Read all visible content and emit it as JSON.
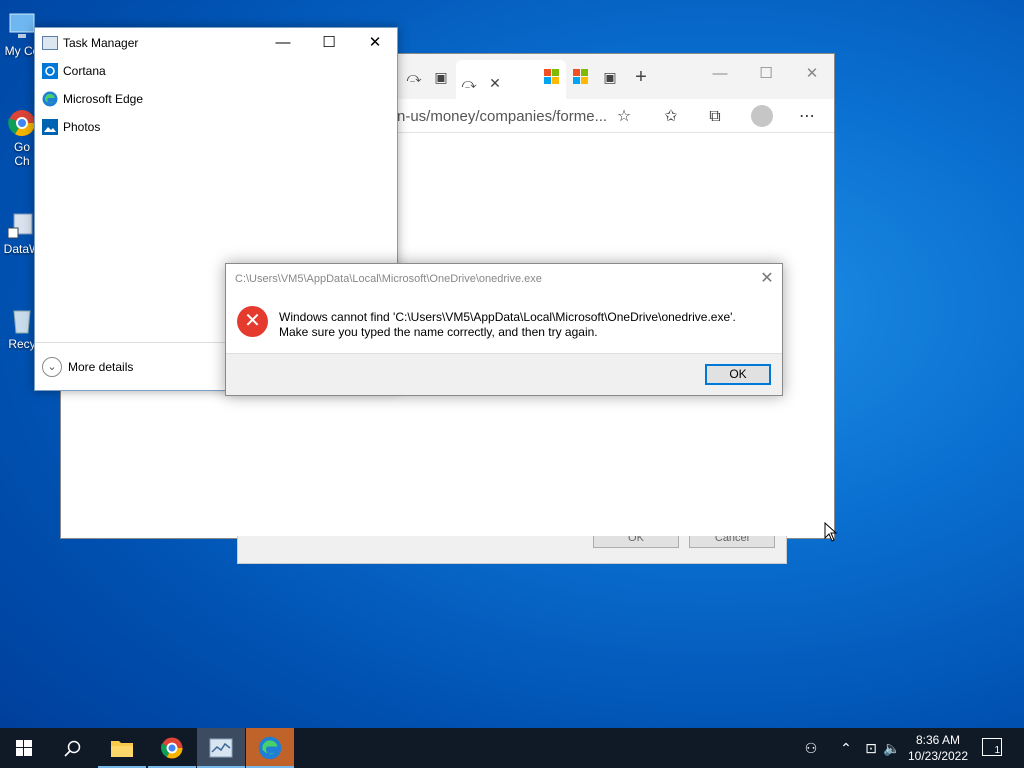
{
  "desktop": {
    "icons": [
      {
        "label": "My Co"
      },
      {
        "label": "Go"
      },
      {
        "label": "Ch"
      },
      {
        "label": "DataW"
      },
      {
        "label": "Recy"
      }
    ]
  },
  "edge": {
    "url_fragment": "n-us/money/companies/forme...",
    "window_controls": {
      "minimize": "—",
      "maximize": "☐",
      "close": "✕"
    }
  },
  "under_dialog": {
    "ok_label": "OK",
    "cancel_label": "Cancel"
  },
  "task_manager": {
    "title": "Task Manager",
    "apps": [
      {
        "name": "Cortana"
      },
      {
        "name": "Microsoft Edge"
      },
      {
        "name": "Photos"
      }
    ],
    "more_details": "More details"
  },
  "error_dialog": {
    "title": "C:\\Users\\VM5\\AppData\\Local\\Microsoft\\OneDrive\\onedrive.exe",
    "message_line1": "Windows cannot find 'C:\\Users\\VM5\\AppData\\Local\\Microsoft\\OneDrive\\onedrive.exe'.",
    "message_line2": "Make sure you typed the name correctly, and then try again.",
    "ok_label": "OK"
  },
  "taskbar": {
    "time": "8:36 AM",
    "date": "10/23/2022",
    "notification_count": "1"
  },
  "colors": {
    "accent": "#0078d7",
    "error_red": "#e53b2f",
    "taskbar": "#101a26"
  }
}
